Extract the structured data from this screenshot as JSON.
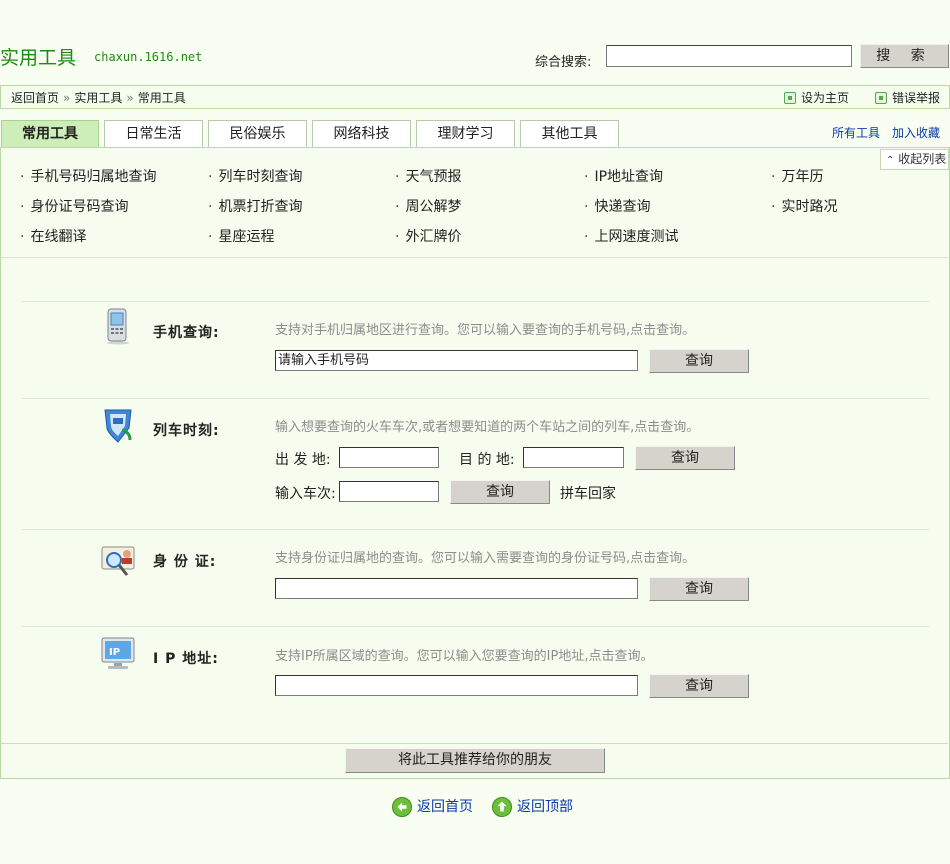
{
  "header": {
    "logo": "实用工具",
    "domain": "chaxun.1616.net",
    "search_label": "综合搜索:",
    "search_value": "",
    "search_button": "搜 索"
  },
  "breadcrumb": {
    "items": [
      "返回首页",
      "实用工具",
      "常用工具"
    ],
    "separator": "»",
    "set_home": "设为主页",
    "report_error": "错误举报"
  },
  "tabs": [
    {
      "label": "常用工具",
      "active": true
    },
    {
      "label": "日常生活",
      "active": false
    },
    {
      "label": "民俗娱乐",
      "active": false
    },
    {
      "label": "网络科技",
      "active": false
    },
    {
      "label": "理财学习",
      "active": false
    },
    {
      "label": "其他工具",
      "active": false
    }
  ],
  "tab_links": {
    "all_tools": "所有工具",
    "add_favorite": "加入收藏"
  },
  "collapse_label": "收起列表",
  "quick_links": [
    [
      "手机号码归属地查询",
      "列车时刻查询",
      "天气预报",
      "IP地址查询",
      "万年历"
    ],
    [
      "身份证号码查询",
      "机票打折查询",
      "周公解梦",
      "快递查询",
      "实时路况"
    ],
    [
      "在线翻译",
      "星座运程",
      "外汇牌价",
      "上网速度测试"
    ]
  ],
  "tools": {
    "phone": {
      "label": "手机查询:",
      "desc": "支持对手机归属地区进行查询。您可以输入要查询的手机号码,点击查询。",
      "input_value": "请输入手机号码",
      "button": "查询",
      "icon": "mobile-phone-icon"
    },
    "train": {
      "label": "列车时刻:",
      "desc": "输入想要查询的火车车次,或者想要知道的两个车站之间的列车,点击查询。",
      "from_label": "出 发 地:",
      "to_label": "目 的 地:",
      "from_value": "",
      "to_value": "",
      "button": "查询",
      "train_no_label": "输入车次:",
      "train_no_value": "",
      "button2": "查询",
      "carpool_link": "拼车回家",
      "icon": "shield-train-icon"
    },
    "idcard": {
      "label": "身 份 证:",
      "desc": "支持身份证归属地的查询。您可以输入需要查询的身份证号码,点击查询。",
      "input_value": "",
      "button": "查询",
      "icon": "id-card-search-icon"
    },
    "ip": {
      "label": "I P 地址:",
      "desc": "支持IP所属区域的查询。您可以输入您要查询的IP地址,点击查询。",
      "input_value": "",
      "button": "查询",
      "icon": "ip-monitor-icon"
    }
  },
  "recommend_button": "将此工具推荐给你的朋友",
  "footer": {
    "back_home": "返回首页",
    "back_top": "返回顶部"
  },
  "colors": {
    "accent_green": "#1f8a10",
    "panel_bg": "#f6fdee",
    "tab_active": "#cdeeb8",
    "link": "#0a3aa8"
  }
}
